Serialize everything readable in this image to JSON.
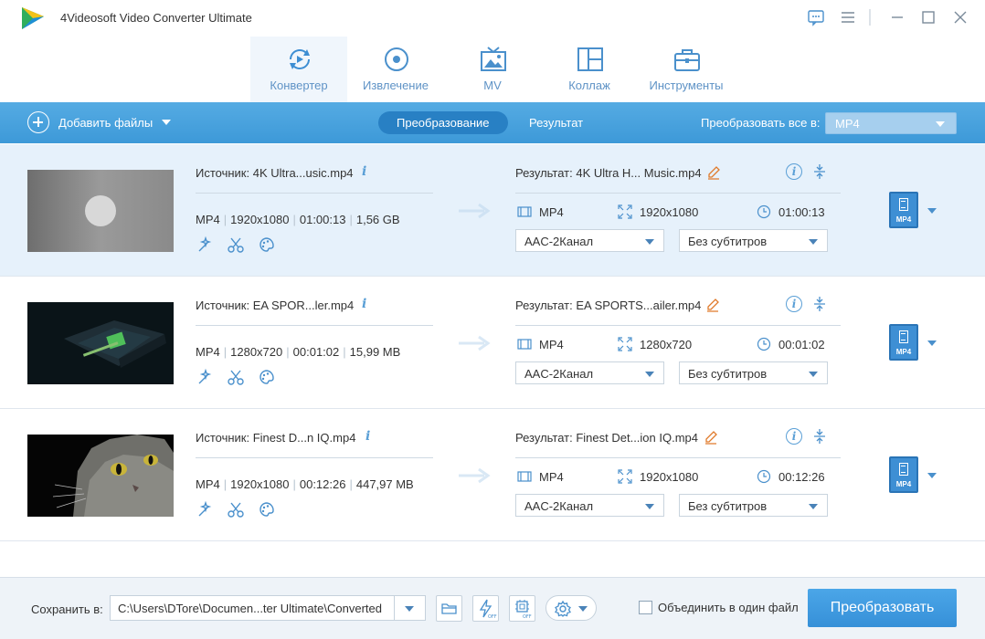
{
  "app": {
    "title": "4Videosoft Video Converter Ultimate"
  },
  "colors": {
    "accent": "#3d9ae0",
    "toolbar": "#4aa3de",
    "selected_row": "#e6f1fb",
    "tab_text": "#5f93c6"
  },
  "modules": [
    {
      "label": "Конвертер",
      "icon": "converter-icon",
      "active": true
    },
    {
      "label": "Извлечение",
      "icon": "ripper-icon",
      "active": false
    },
    {
      "label": "MV",
      "icon": "mv-icon",
      "active": false
    },
    {
      "label": "Коллаж",
      "icon": "collage-icon",
      "active": false
    },
    {
      "label": "Инструменты",
      "icon": "toolbox-icon",
      "active": false
    }
  ],
  "toolbar": {
    "add_files": "Добавить файлы",
    "tab_convert": "Преобразование",
    "tab_result": "Результат",
    "convert_all_label": "Преобразовать все в:",
    "convert_all_value": "MP4"
  },
  "files": [
    {
      "source": "Источник: 4K Ultra...usic.mp4",
      "format": "MP4",
      "resolution": "1920x1080",
      "duration": "01:00:13",
      "size": "1,56 GB",
      "result": "Результат: 4K Ultra H... Music.mp4",
      "out_format": "MP4",
      "out_resolution": "1920x1080",
      "out_duration": "01:00:13",
      "audio": "AAC-2Канал",
      "subtitle": "Без субтитров",
      "badge": "MP4"
    },
    {
      "source": "Источник: EA SPOR...ler.mp4",
      "format": "MP4",
      "resolution": "1280x720",
      "duration": "00:01:02",
      "size": "15,99 MB",
      "result": "Результат: EA SPORTS...ailer.mp4",
      "out_format": "MP4",
      "out_resolution": "1280x720",
      "out_duration": "00:01:02",
      "audio": "AAC-2Канал",
      "subtitle": "Без субтитров",
      "badge": "MP4"
    },
    {
      "source": "Источник: Finest D...n IQ.mp4",
      "format": "MP4",
      "resolution": "1920x1080",
      "duration": "00:12:26",
      "size": "447,97 MB",
      "result": "Результат: Finest Det...ion IQ.mp4",
      "out_format": "MP4",
      "out_resolution": "1920x1080",
      "out_duration": "00:12:26",
      "audio": "AAC-2Канал",
      "subtitle": "Без субтитров",
      "badge": "MP4"
    }
  ],
  "bottom": {
    "save_label": "Сохранить в:",
    "save_path": "C:\\Users\\DTore\\Documen...ter Ultimate\\Converted",
    "merge_label": "Объединить в один файл",
    "merge_checked": false,
    "convert_button": "Преобразовать"
  }
}
